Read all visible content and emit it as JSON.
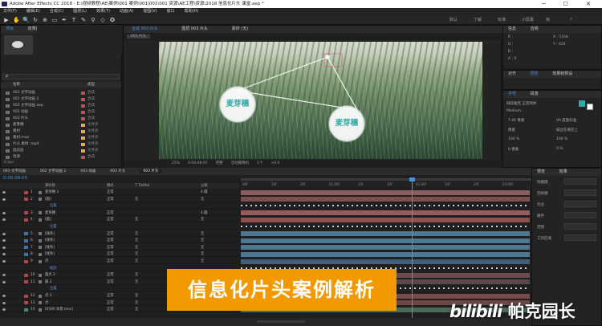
{
  "window": {
    "title": "Adobe After Effects CC 2018 - E:\\视频教程\\AE\\案例\\001 案例\\001\\001\\001 资源\\AE工程\\资源\\2018 信息化片头 课堂.aep *",
    "controls": "─ ☐ ✕"
  },
  "menu": [
    "文件(F)",
    "编辑(E)",
    "合成(C)",
    "图层(L)",
    "效果(T)",
    "动画(A)",
    "视图(V)",
    "窗口",
    "帮助(H)"
  ],
  "toolbar": {
    "tools": [
      "▶",
      "✋",
      "🔍",
      "↻",
      "⊕",
      "▭",
      "✒",
      "T",
      "✎",
      "⚲",
      "◇",
      "✪"
    ],
    "workspace": [
      "默认",
      "了解",
      "标准",
      "小屏幕",
      "库",
      "»"
    ]
  },
  "project": {
    "tabs": [
      "项目",
      "效果控件"
    ],
    "search_placeholder": "ρ",
    "header_name": "名称",
    "header_type": "类型",
    "items": [
      {
        "name": "001 文字动画",
        "type": "合成",
        "color": "#c05050"
      },
      {
        "name": "001 文字动画 2",
        "type": "合成",
        "color": "#c05050"
      },
      {
        "name": "002 文字动画.aep",
        "type": "合成",
        "color": "#c05050"
      },
      {
        "name": "002 动画",
        "type": "合成",
        "color": "#c05050"
      },
      {
        "name": "003 片头",
        "type": "合成",
        "color": "#c05050"
      },
      {
        "name": "麦芽穗",
        "type": "文件夹",
        "color": "#d9b04a"
      },
      {
        "name": "素材",
        "type": "文件夹",
        "color": "#d9b04a"
      },
      {
        "name": "素材.mov",
        "type": "文件夹",
        "color": "#d9b04a"
      },
      {
        "name": "片头 素材 .mp4",
        "type": "文件夹",
        "color": "#d9b04a"
      },
      {
        "name": "固态层",
        "type": "文件夹",
        "color": "#d9b04a"
      },
      {
        "name": "资源",
        "type": "合成",
        "color": "#c05050"
      }
    ],
    "footer": "8 bpc"
  },
  "viewer": {
    "tabs": [
      "合成 003 片头",
      "图层 003 片头",
      "素材 (无)"
    ],
    "breadcrumb": "003 片头",
    "bottom_bar": [
      "25%",
      "0:00:08:05",
      "完整",
      "活动摄像机",
      "1个",
      "+0.0"
    ],
    "bubbles": [
      "麦芽穗",
      "麦芽穗"
    ]
  },
  "info_panel": {
    "tabs": [
      "信息",
      "音频"
    ],
    "lines": [
      "R :",
      "G :",
      "B :",
      "A : 0",
      "X : 1164",
      "Y : 624"
    ]
  },
  "align_panel": {
    "tabs": [
      "对齐",
      "预览",
      "效果和预设"
    ]
  },
  "character_panel": {
    "tabs": [
      "字符",
      "段落"
    ],
    "font": "微软雅黑 正黑简体",
    "style": "Medium",
    "rows": [
      "T 46 像素",
      "VA 度量标准",
      "像素",
      "描边在填充上",
      "100 %",
      "100 %",
      "0 像素",
      "0 %"
    ]
  },
  "timeline": {
    "tabs": [
      "003 文字动画",
      "002 文字动画 2",
      "003 动画",
      "003 片头",
      "003 片头"
    ],
    "timecode": "0:00:08:05",
    "headers": [
      "源名称",
      "模式",
      "T TrkMat",
      "父级"
    ],
    "ruler": [
      "00f",
      "10f",
      "20f",
      "01:00f",
      "10f",
      "20f",
      "02:00f",
      "10f",
      "20f",
      "03:00f"
    ],
    "layers": [
      {
        "num": "1",
        "name": "麦芽穗 3",
        "mode": "正常",
        "trk": "",
        "parent": "4.圆",
        "color": "#a84a4a",
        "bar": "#8c5f5f",
        "sub": false
      },
      {
        "num": "2",
        "name": "[圆]",
        "mode": "正常",
        "trk": "无",
        "parent": "无",
        "color": "#a84a4a",
        "bar": "#7a4f4f",
        "sub": false
      },
      {
        "num": "",
        "name": "位置",
        "mode": "",
        "trk": "",
        "parent": "",
        "color": "",
        "bar": "",
        "sub": true
      },
      {
        "num": "3",
        "name": "麦芽穗",
        "mode": "正常",
        "trk": "",
        "parent": "4.圆",
        "color": "#a84a4a",
        "bar": "#9b5a5a",
        "sub": false
      },
      {
        "num": "4",
        "name": "[圆]",
        "mode": "正常",
        "trk": "无",
        "parent": "无",
        "color": "#a84a4a",
        "bar": "#8c5252",
        "sub": false
      },
      {
        "num": "",
        "name": "位置",
        "mode": "",
        "trk": "",
        "parent": "",
        "color": "",
        "bar": "",
        "sub": true
      },
      {
        "num": "5",
        "name": "[线条]",
        "mode": "正常",
        "trk": "无",
        "parent": "无",
        "color": "#4a6fa8",
        "bar": "#4e7892",
        "sub": false
      },
      {
        "num": "6",
        "name": "[线条]",
        "mode": "正常",
        "trk": "无",
        "parent": "无",
        "color": "#4a6fa8",
        "bar": "#4e7892",
        "sub": false
      },
      {
        "num": "7",
        "name": "[线条]",
        "mode": "正常",
        "trk": "无",
        "parent": "无",
        "color": "#4a6fa8",
        "bar": "#4e7892",
        "sub": false
      },
      {
        "num": "8",
        "name": "[线条]",
        "mode": "正常",
        "trk": "无",
        "parent": "无",
        "color": "#4a6fa8",
        "bar": "#4e7892",
        "sub": false
      },
      {
        "num": "9",
        "name": "点",
        "mode": "正常",
        "trk": "无",
        "parent": "无",
        "color": "#a84a4a",
        "bar": "#3f5f7a",
        "sub": false
      },
      {
        "num": "",
        "name": "缩放",
        "mode": "",
        "trk": "",
        "parent": "",
        "color": "",
        "bar": "",
        "sub": true
      },
      {
        "num": "10",
        "name": "圆点 2",
        "mode": "正常",
        "trk": "无",
        "parent": "无",
        "color": "#a84a4a",
        "bar": "#6b4b4b",
        "sub": false
      },
      {
        "num": "11",
        "name": "圆 2",
        "mode": "正常",
        "trk": "无",
        "parent": "无",
        "color": "#a84a4a",
        "bar": "#5c4848",
        "sub": false
      },
      {
        "num": "",
        "name": "位置",
        "mode": "",
        "trk": "",
        "parent": "",
        "color": "",
        "bar": "",
        "sub": true
      },
      {
        "num": "12",
        "name": "点 3",
        "mode": "正常",
        "trk": "无",
        "parent": "无",
        "color": "#a84a4a",
        "bar": "#7a4a4a",
        "sub": false
      },
      {
        "num": "13",
        "name": "点",
        "mode": "正常",
        "trk": "无",
        "parent": "无",
        "color": "#a84a4a",
        "bar": "#6e4848",
        "sub": false
      },
      {
        "num": "14",
        "name": "[0580 背景.mov]",
        "mode": "正常",
        "trk": "无",
        "parent": "无",
        "color": "#4a8a6a",
        "bar": "#4b6b5a",
        "sub": false
      }
    ]
  },
  "preview_panel": {
    "tabs": [
      "预览",
      "效果"
    ],
    "rows": [
      "快捷键",
      "空格键",
      "包含",
      "缓存",
      "范围",
      "工作区域"
    ]
  },
  "overlay": {
    "banner": "信息化片头案例解析",
    "watermark_logo": "bilibili",
    "watermark_text": "帕克园长"
  }
}
